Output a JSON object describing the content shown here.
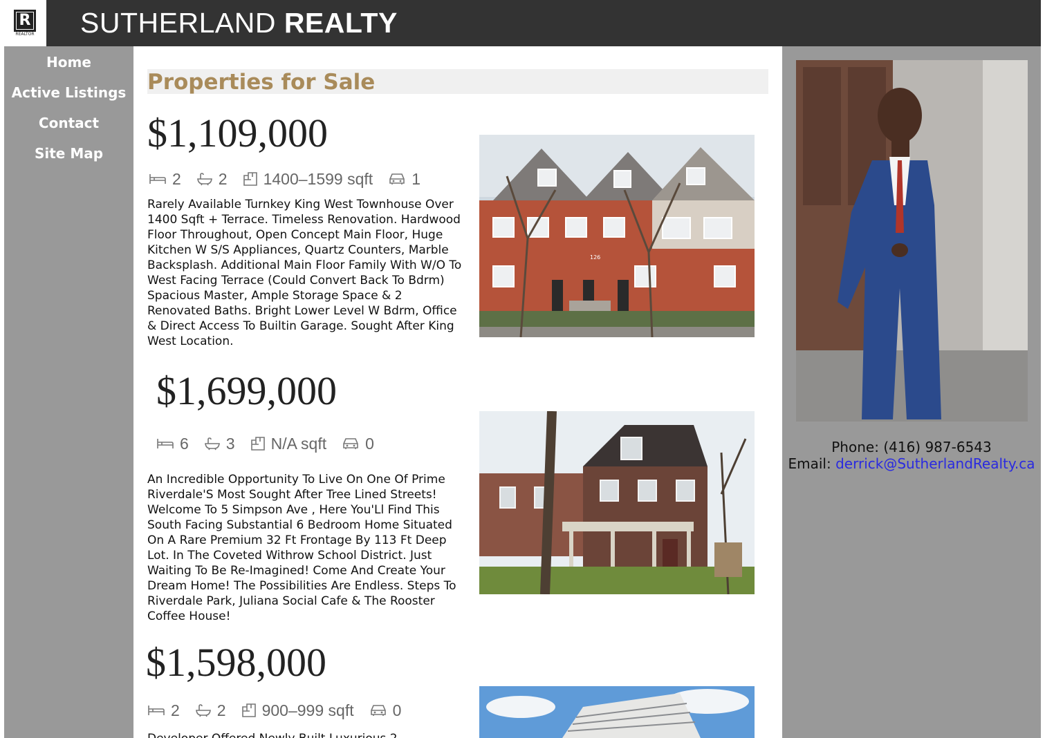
{
  "header": {
    "logo_text": "R",
    "logo_caption": "REALTOR",
    "brand_light": "SUTHERLAND ",
    "brand_bold": "REALTY"
  },
  "nav": {
    "items": [
      "Home",
      "Active Listings",
      "Contact",
      "Site Map"
    ]
  },
  "main": {
    "title": "Properties for Sale",
    "listings": [
      {
        "price": "$1,109,000",
        "beds": "2",
        "baths": "2",
        "sqft": "1400–1599 sqft",
        "parking": "1",
        "description": "Rarely Available Turnkey King West Townhouse Over 1400 Sqft + Terrace. Timeless Renovation. Hardwood Floor Throughout, Open Concept Main Floor, Huge Kitchen W S/S Appliances, Quartz Counters, Marble Backsplash. Additional Main Floor Family With W/O To West Facing Terrace (Could Convert Back To Bdrm) Spacious Master, Ample Storage Space & 2 Renovated Baths. Bright Lower Level W Bdrm, Office & Direct Access To Builtin Garage. Sought After King West Location.",
        "photo_number": "126"
      },
      {
        "price": "$1,699,000",
        "beds": "6",
        "baths": "3",
        "sqft": "N/A sqft",
        "parking": "0",
        "description": "An Incredible Opportunity To Live On One Of Prime Riverdale'S Most Sought After Tree Lined Streets! Welcome To 5 Simpson Ave , Here You'Ll Find This South Facing Substantial 6 Bedroom Home Situated On A Rare Premium 32 Ft Frontage By 113 Ft Deep Lot. In The Coveted Withrow School District. Just Waiting To Be Re-Imagined! Come And Create Your Dream Home! The Possibilities Are Endless. Steps To Riverdale Park, Juliana Social Cafe & The Rooster Coffee House!"
      },
      {
        "price": "$1,598,000",
        "beds": "2",
        "baths": "2",
        "sqft": "900–999 sqft",
        "parking": "0",
        "description": "Developer Offered Newly Built Luxurious 2"
      }
    ]
  },
  "aside": {
    "phone_label": "Phone: ",
    "phone": "(416) 987-6543",
    "email_label": "Email: ",
    "email": "derrick@SutherlandRealty.ca"
  },
  "colors": {
    "header_bg": "#333333",
    "side_bg": "#999999",
    "title_color": "#a98b5a",
    "link_color": "#2a2ae0"
  }
}
